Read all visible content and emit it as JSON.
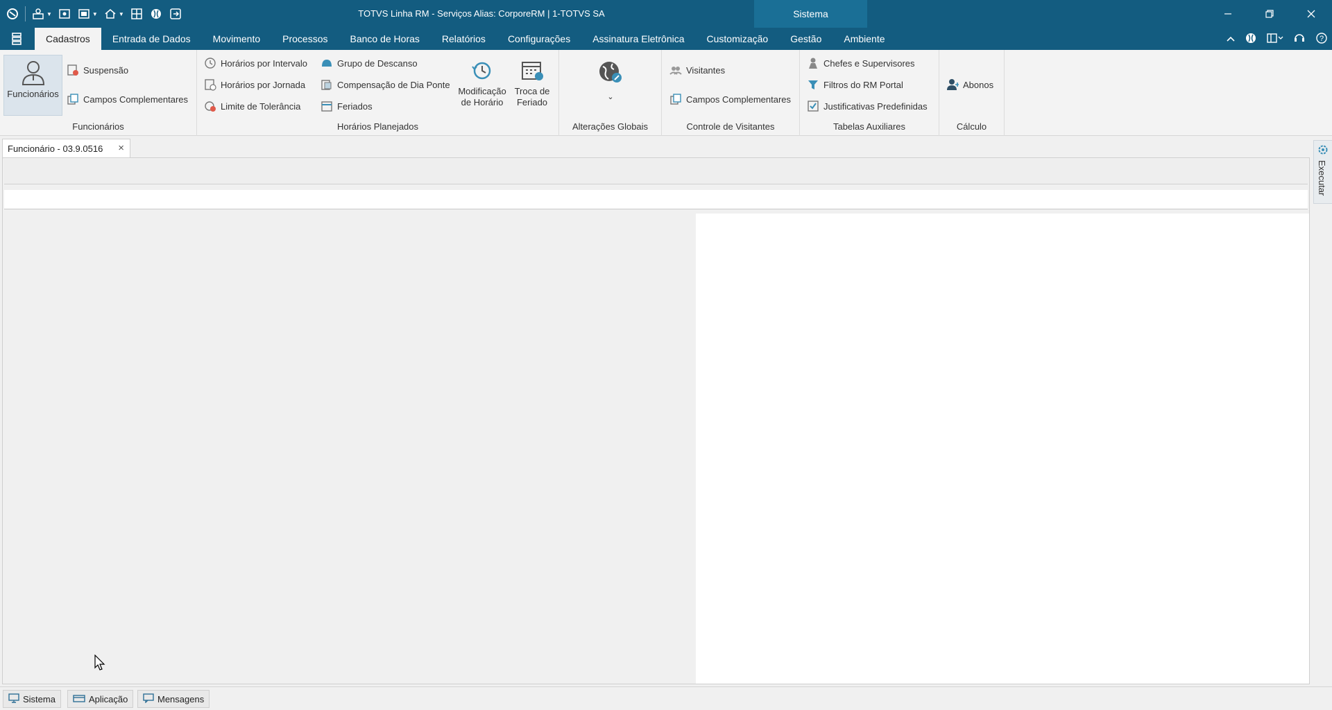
{
  "window": {
    "title": "TOTVS Linha RM - Serviços  Alias: CorporeRM | 1-TOTVS SA",
    "context_tab": "Sistema"
  },
  "menu": {
    "tabs": [
      "Cadastros",
      "Entrada de Dados",
      "Movimento",
      "Processos",
      "Banco de Horas",
      "Relatórios",
      "Configurações",
      "Assinatura Eletrônica",
      "Customização",
      "Gestão",
      "Ambiente"
    ],
    "active": "Cadastros"
  },
  "ribbon": {
    "funcionarios": {
      "label": "Funcionários",
      "big_button": "Funcionários",
      "suspensao": "Suspensão",
      "campos": "Campos Complementares"
    },
    "horarios": {
      "label": "Horários Planejados",
      "intervalo": "Horários por Intervalo",
      "jornada": "Horários por Jornada",
      "tolerancia": "Limite de Tolerância",
      "descanso": "Grupo de Descanso",
      "compensacao": "Compensação de Dia Ponte",
      "feriados": "Feriados",
      "modificacao_l1": "Modificação",
      "modificacao_l2": "de Horário",
      "troca_l1": "Troca de",
      "troca_l2": "Feriado"
    },
    "alteracoes": {
      "label": "Alterações Globais"
    },
    "visitantes": {
      "label": "Controle de Visitantes",
      "visitantes": "Visitantes",
      "campos": "Campos Complementares"
    },
    "tabelas": {
      "label": "Tabelas Auxiliares",
      "chefes": "Chefes e Supervisores",
      "filtros": "Filtros do RM Portal",
      "justificativas": "Justificativas Predefinidas"
    },
    "calculo": {
      "label": "Cálculo",
      "abonos": "Abonos"
    }
  },
  "document": {
    "tab_title": "Funcionário - 03.9.0516"
  },
  "side_panel": {
    "label": "Executar"
  },
  "status": {
    "sistema": "Sistema",
    "aplicacao": "Aplicação",
    "mensagens": "Mensagens"
  },
  "colors": {
    "titlebar": "#135c80",
    "context_tab": "#1a6f96",
    "ribbon": "#f3f3f3"
  }
}
